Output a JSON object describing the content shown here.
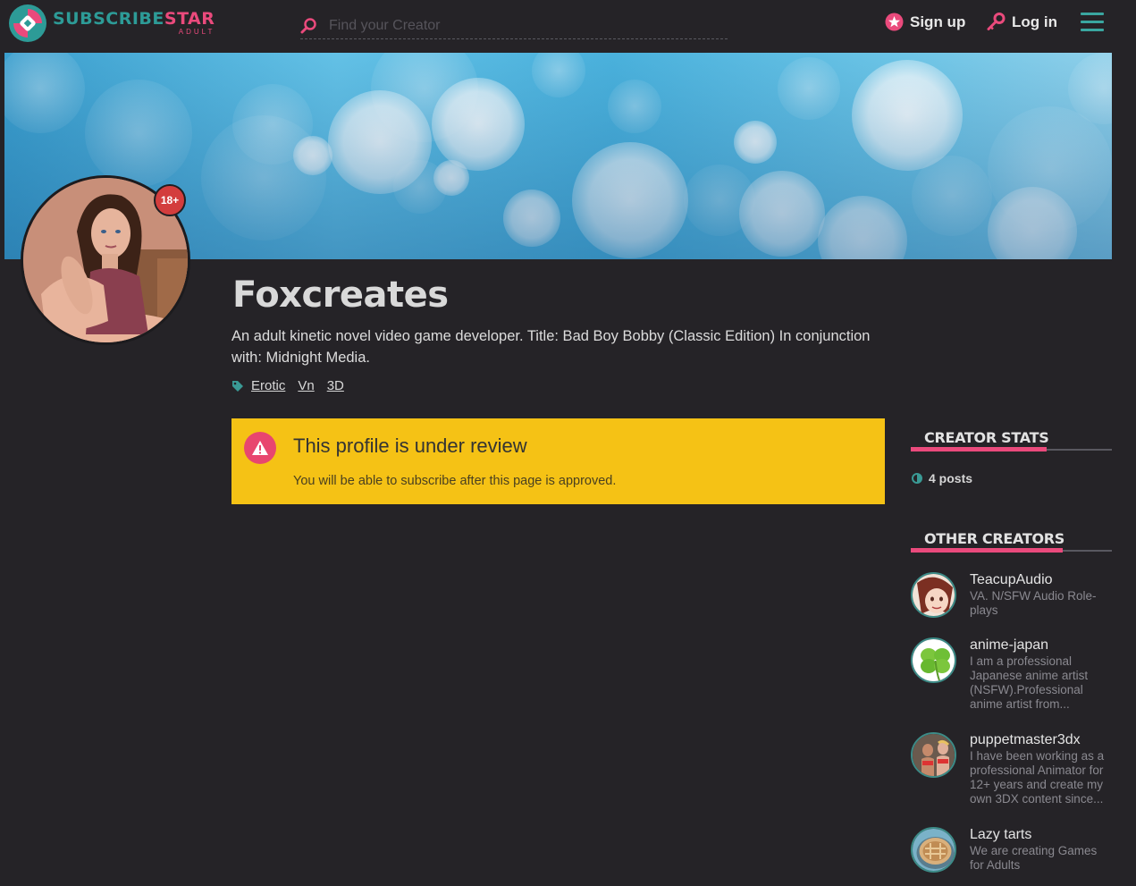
{
  "header": {
    "logo_line1_a": "SUBSCRIBE",
    "logo_line1_b": "STAR",
    "logo_line2": "ADULT",
    "search_placeholder": "Find your Creator",
    "signup_label": "Sign up",
    "login_label": "Log in"
  },
  "profile": {
    "name": "Foxcreates",
    "badge": "18+",
    "description": "An adult kinetic novel video game developer. Title: Bad Boy Bobby (Classic Edition) In conjunction with: Midnight Media.",
    "tags": [
      "Erotic",
      "Vn",
      "3D"
    ]
  },
  "review": {
    "title": "This profile is under review",
    "subtitle": "You will be able to subscribe after this page is approved."
  },
  "sidebar": {
    "stats_title": "CREATOR STATS",
    "posts": "4 posts",
    "other_title": "OTHER CREATORS",
    "creators": [
      {
        "name": "TeacupAudio",
        "desc": "VA. N/SFW Audio Role-plays"
      },
      {
        "name": "anime-japan",
        "desc": "I am a professional Japanese anime artist (NSFW).Professional anime artist from..."
      },
      {
        "name": "puppetmaster3dx",
        "desc": "I have been working as a professional Animator for 12+ years and create my own 3DX content since..."
      },
      {
        "name": "Lazy tarts",
        "desc": "We are creating Games for Adults"
      }
    ]
  },
  "colors": {
    "accent_pink": "#ea4a7c",
    "accent_teal": "#2d9b97",
    "review_yellow": "#f5c215",
    "background": "#252327"
  }
}
